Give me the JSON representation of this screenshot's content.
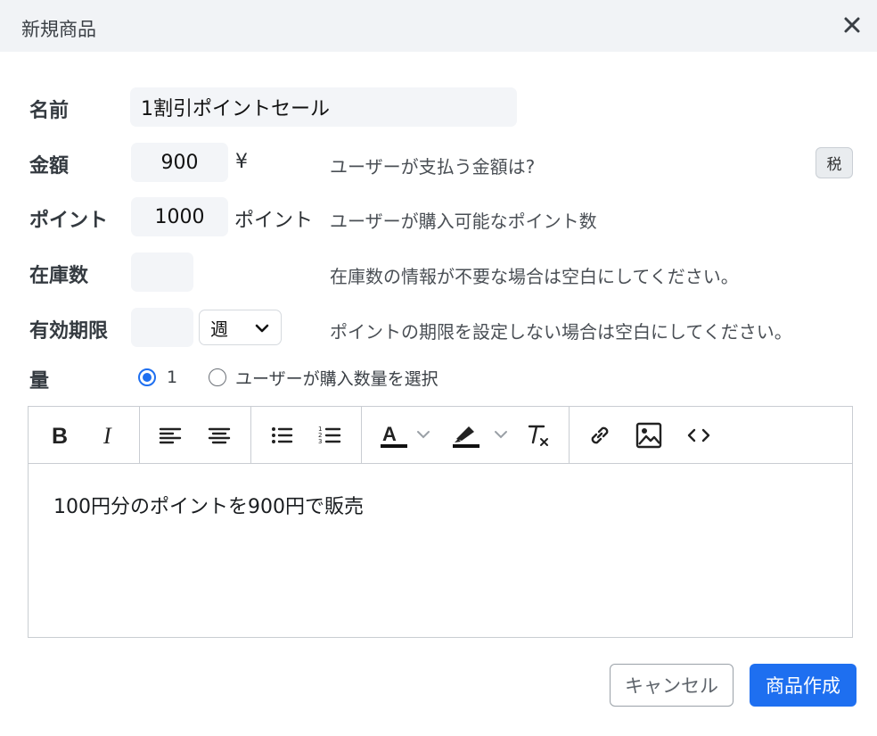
{
  "modal": {
    "title": "新規商品",
    "close_icon": "close-icon"
  },
  "form": {
    "name": {
      "label": "名前",
      "value": "1割引ポイントセール"
    },
    "price": {
      "label": "金額",
      "value": "900",
      "unit": "¥",
      "help": "ユーザーが支払う金額は?",
      "tax_button": "税"
    },
    "points": {
      "label": "ポイント",
      "value": "1000",
      "unit": "ポイント",
      "help": "ユーザーが購入可能なポイント数"
    },
    "stock": {
      "label": "在庫数",
      "value": "",
      "help": "在庫数の情報が不要な場合は空白にしてください。"
    },
    "expiry": {
      "label": "有効期限",
      "value": "",
      "period_selected": "週",
      "help": "ポイントの期限を設定しない場合は空白にしてください。"
    },
    "quantity": {
      "label": "量",
      "options": [
        {
          "label": "1",
          "checked": true
        },
        {
          "label": "ユーザーが購入数量を選択",
          "checked": false
        }
      ]
    }
  },
  "editor": {
    "toolbar_icons": [
      "bold-icon",
      "italic-icon",
      "align-left-icon",
      "align-center-icon",
      "bullet-list-icon",
      "numbered-list-icon",
      "text-color-icon",
      "highlight-icon",
      "clear-format-icon",
      "link-icon",
      "image-icon",
      "code-icon"
    ],
    "content": "100円分のポイントを900円で販売"
  },
  "footer": {
    "cancel": "キャンセル",
    "create": "商品作成"
  },
  "colors": {
    "primary": "#1e6ff0",
    "header_bg": "#f1f3f6",
    "field_bg": "#f3f5f8"
  }
}
